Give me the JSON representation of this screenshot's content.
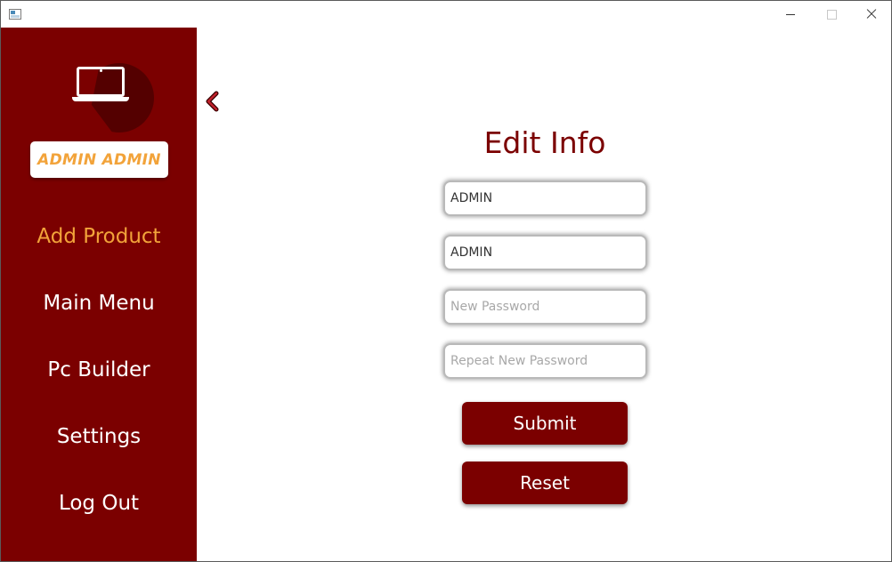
{
  "window": {
    "icons": {
      "app": "app-window-icon",
      "minimize": "minimize-icon",
      "maximize": "maximize-icon",
      "close": "close-icon"
    }
  },
  "sidebar": {
    "logo_icon": "laptop-icon",
    "user_name": "ADMIN ADMIN",
    "nav": [
      {
        "label": "Add Product",
        "active": true
      },
      {
        "label": "Main Menu",
        "active": false
      },
      {
        "label": "Pc Builder",
        "active": false
      },
      {
        "label": "Settings",
        "active": false
      },
      {
        "label": "Log Out",
        "active": false
      }
    ],
    "collapse_icon": "chevron-left-icon"
  },
  "main": {
    "title": "Edit Info",
    "fields": [
      {
        "value": "ADMIN",
        "placeholder": ""
      },
      {
        "value": "ADMIN",
        "placeholder": ""
      },
      {
        "value": "",
        "placeholder": "New Password"
      },
      {
        "value": "",
        "placeholder": "Repeat New Password"
      }
    ],
    "submit_label": "Submit",
    "reset_label": "Reset"
  },
  "colors": {
    "accent": "#7b0000",
    "highlight": "#f2a33a",
    "background": "#ffffff"
  }
}
